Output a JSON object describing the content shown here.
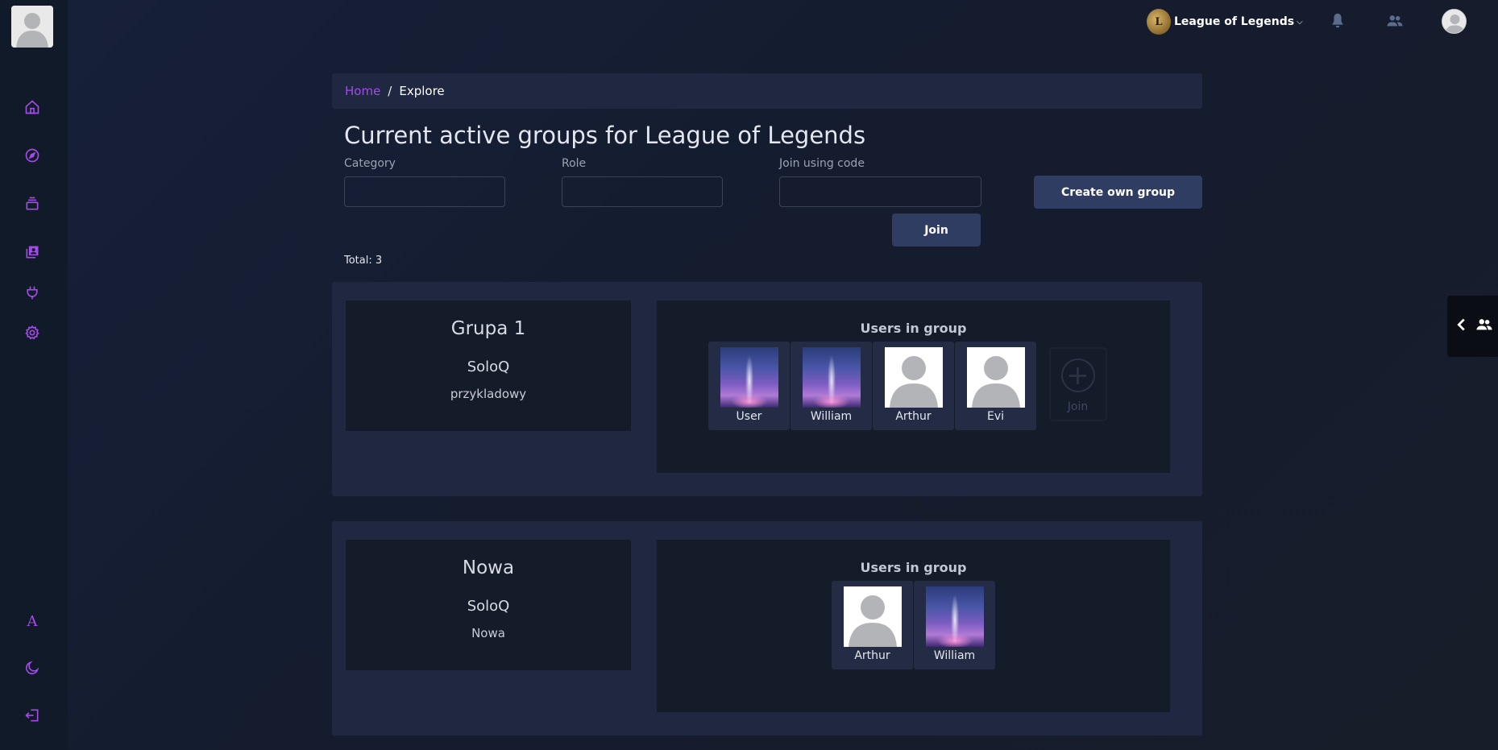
{
  "colors": {
    "accent": "#a34be6",
    "button": "#2f3d63",
    "panel": "#1f2840",
    "card": "#141c2a",
    "sidebar": "#111a28"
  },
  "sidebar": {
    "items": [
      {
        "icon": "home-icon"
      },
      {
        "icon": "compass-icon"
      },
      {
        "icon": "layers-icon"
      },
      {
        "icon": "contacts-icon"
      },
      {
        "icon": "plug-icon"
      },
      {
        "icon": "gear-icon"
      }
    ],
    "bottom_items": [
      {
        "icon": "font-icon",
        "glyph": "A"
      },
      {
        "icon": "moon-icon"
      },
      {
        "icon": "logout-icon"
      }
    ]
  },
  "topbar": {
    "game_logo_text": "L",
    "game_name": "League of Legends",
    "icons": [
      "bell-icon",
      "people-icon"
    ]
  },
  "breadcrumb": {
    "home": "Home",
    "separator": "/",
    "current": "Explore"
  },
  "page": {
    "title": "Current active groups for League of Legends"
  },
  "filters": {
    "category_label": "Category",
    "category_value": "",
    "role_label": "Role",
    "role_value": "",
    "code_label": "Join using code",
    "code_value": "",
    "join_button": "Join",
    "create_button": "Create own group"
  },
  "total": "Total: 3",
  "groups": [
    {
      "name": "Grupa 1",
      "category": "SoloQ",
      "description": "przykladowy",
      "users_title": "Users in group",
      "users": [
        {
          "name": "User",
          "avatar": "sky"
        },
        {
          "name": "William",
          "avatar": "sky"
        },
        {
          "name": "Arthur",
          "avatar": "blank"
        },
        {
          "name": "Evi",
          "avatar": "blank"
        }
      ],
      "join_label": "Join"
    },
    {
      "name": "Nowa",
      "category": "SoloQ",
      "description": "Nowa",
      "users_title": "Users in group",
      "users": [
        {
          "name": "Arthur",
          "avatar": "blank"
        },
        {
          "name": "William",
          "avatar": "sky"
        }
      ]
    }
  ],
  "friends_panel": {
    "icons": [
      "chevron-left-icon",
      "people-icon"
    ]
  }
}
